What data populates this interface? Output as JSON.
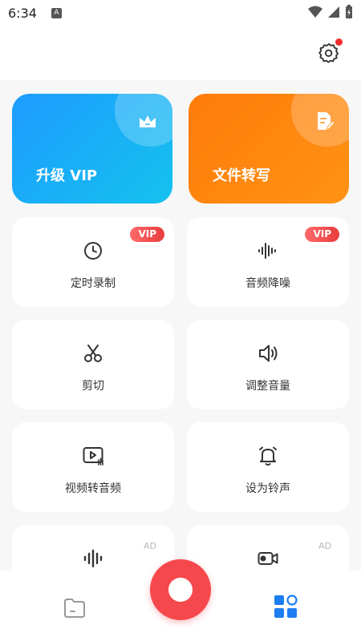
{
  "status_bar": {
    "time": "6:34",
    "indicator": "A"
  },
  "header": {
    "settings_icon": "gear-icon",
    "has_notification_dot": true
  },
  "feature_cards": [
    {
      "label": "升级 VIP",
      "icon": "crown-icon",
      "color": "#1e9cff"
    },
    {
      "label": "文件转写",
      "icon": "document-edit-icon",
      "color": "#ff7b0a"
    }
  ],
  "tools": [
    {
      "label": "定时录制",
      "icon": "clock-icon",
      "badge": "VIP"
    },
    {
      "label": "音频降噪",
      "icon": "waveform-icon",
      "badge": "VIP"
    },
    {
      "label": "剪切",
      "icon": "scissors-icon"
    },
    {
      "label": "调整音量",
      "icon": "volume-icon"
    },
    {
      "label": "视频转音频",
      "icon": "video-to-audio-icon"
    },
    {
      "label": "设为铃声",
      "icon": "bell-icon"
    },
    {
      "label": "",
      "icon": "audio-bars-icon",
      "badge": "AD"
    },
    {
      "label": "",
      "icon": "video-camera-icon",
      "badge": "AD"
    }
  ],
  "bottom_nav": {
    "left_icon": "folder-icon",
    "center_icon": "record-icon",
    "right_icon": "apps-grid-icon",
    "accent": "#1e7df0",
    "record_color": "#f5484c"
  }
}
